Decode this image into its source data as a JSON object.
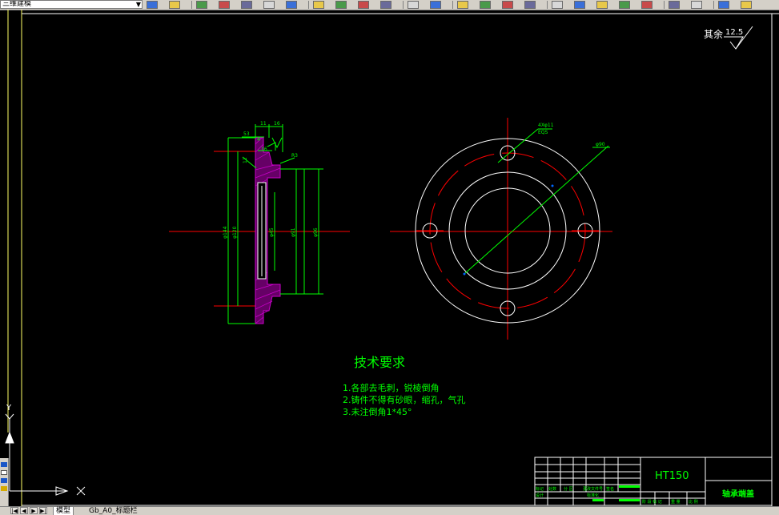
{
  "toolbar": {
    "workspace": "三维建模",
    "icons": [
      "workspace-settings-icon",
      "new-icon",
      "open-icon",
      "save-icon",
      "plot-icon",
      "preview-icon",
      "publish-icon",
      "cut-icon",
      "copy-icon",
      "paste-icon",
      "matchprop-icon",
      "undo-icon",
      "redo-icon",
      "pan-icon",
      "zoom-realtime-icon",
      "zoom-window-icon",
      "zoom-previous-icon",
      "properties-icon",
      "design-center-icon",
      "tool-palettes-icon",
      "sheet-set-icon",
      "markup-icon",
      "calculator-icon",
      "help-icon",
      "layers-icon",
      "layer-prev-icon"
    ],
    "colors": {
      "bg": "#d4d0c8",
      "border": "#808080"
    }
  },
  "drawing": {
    "colors": {
      "background": "#000000",
      "green": "#00ff00",
      "red": "#ff0000",
      "white": "#ffffff",
      "frame": "#ffff66",
      "hatch": "#cc00cc",
      "text": "#00ff00"
    },
    "roughness": {
      "label": "其余",
      "value": "12.5"
    },
    "section_dims": [
      "53",
      "11",
      "16",
      "16",
      "4",
      "12",
      "R3",
      "φ144",
      "φ120",
      "φ45",
      "φ91",
      "φ96"
    ],
    "plan_leaders": {
      "holes": "4Xφ11",
      "holes_sub": "EQS",
      "pcd": "φ90"
    },
    "tech": {
      "title": "技术要求",
      "items": [
        "1.各部去毛刺，锐棱倒角",
        "2.铸件不得有砂眼，缩孔，气孔",
        "3.未注倒角1*45°"
      ]
    },
    "title_block": {
      "material": "HT150",
      "part_name": "轴承端盖",
      "cells_row1": [
        "标记",
        "处数",
        "分 区",
        "更改文件号",
        "签名"
      ],
      "cells_row2": [
        "设计",
        "",
        "",
        "标准化"
      ],
      "cells_right": [
        "阶 段 标 记",
        "重 量",
        "比 例"
      ]
    }
  },
  "ucs": {
    "y": "Y",
    "x": "X"
  },
  "tabs": {
    "nav": [
      "|◀",
      "◀",
      "▶",
      "▶|"
    ],
    "items": [
      "模型",
      "Gb_A0_标题栏"
    ],
    "active": 0
  }
}
